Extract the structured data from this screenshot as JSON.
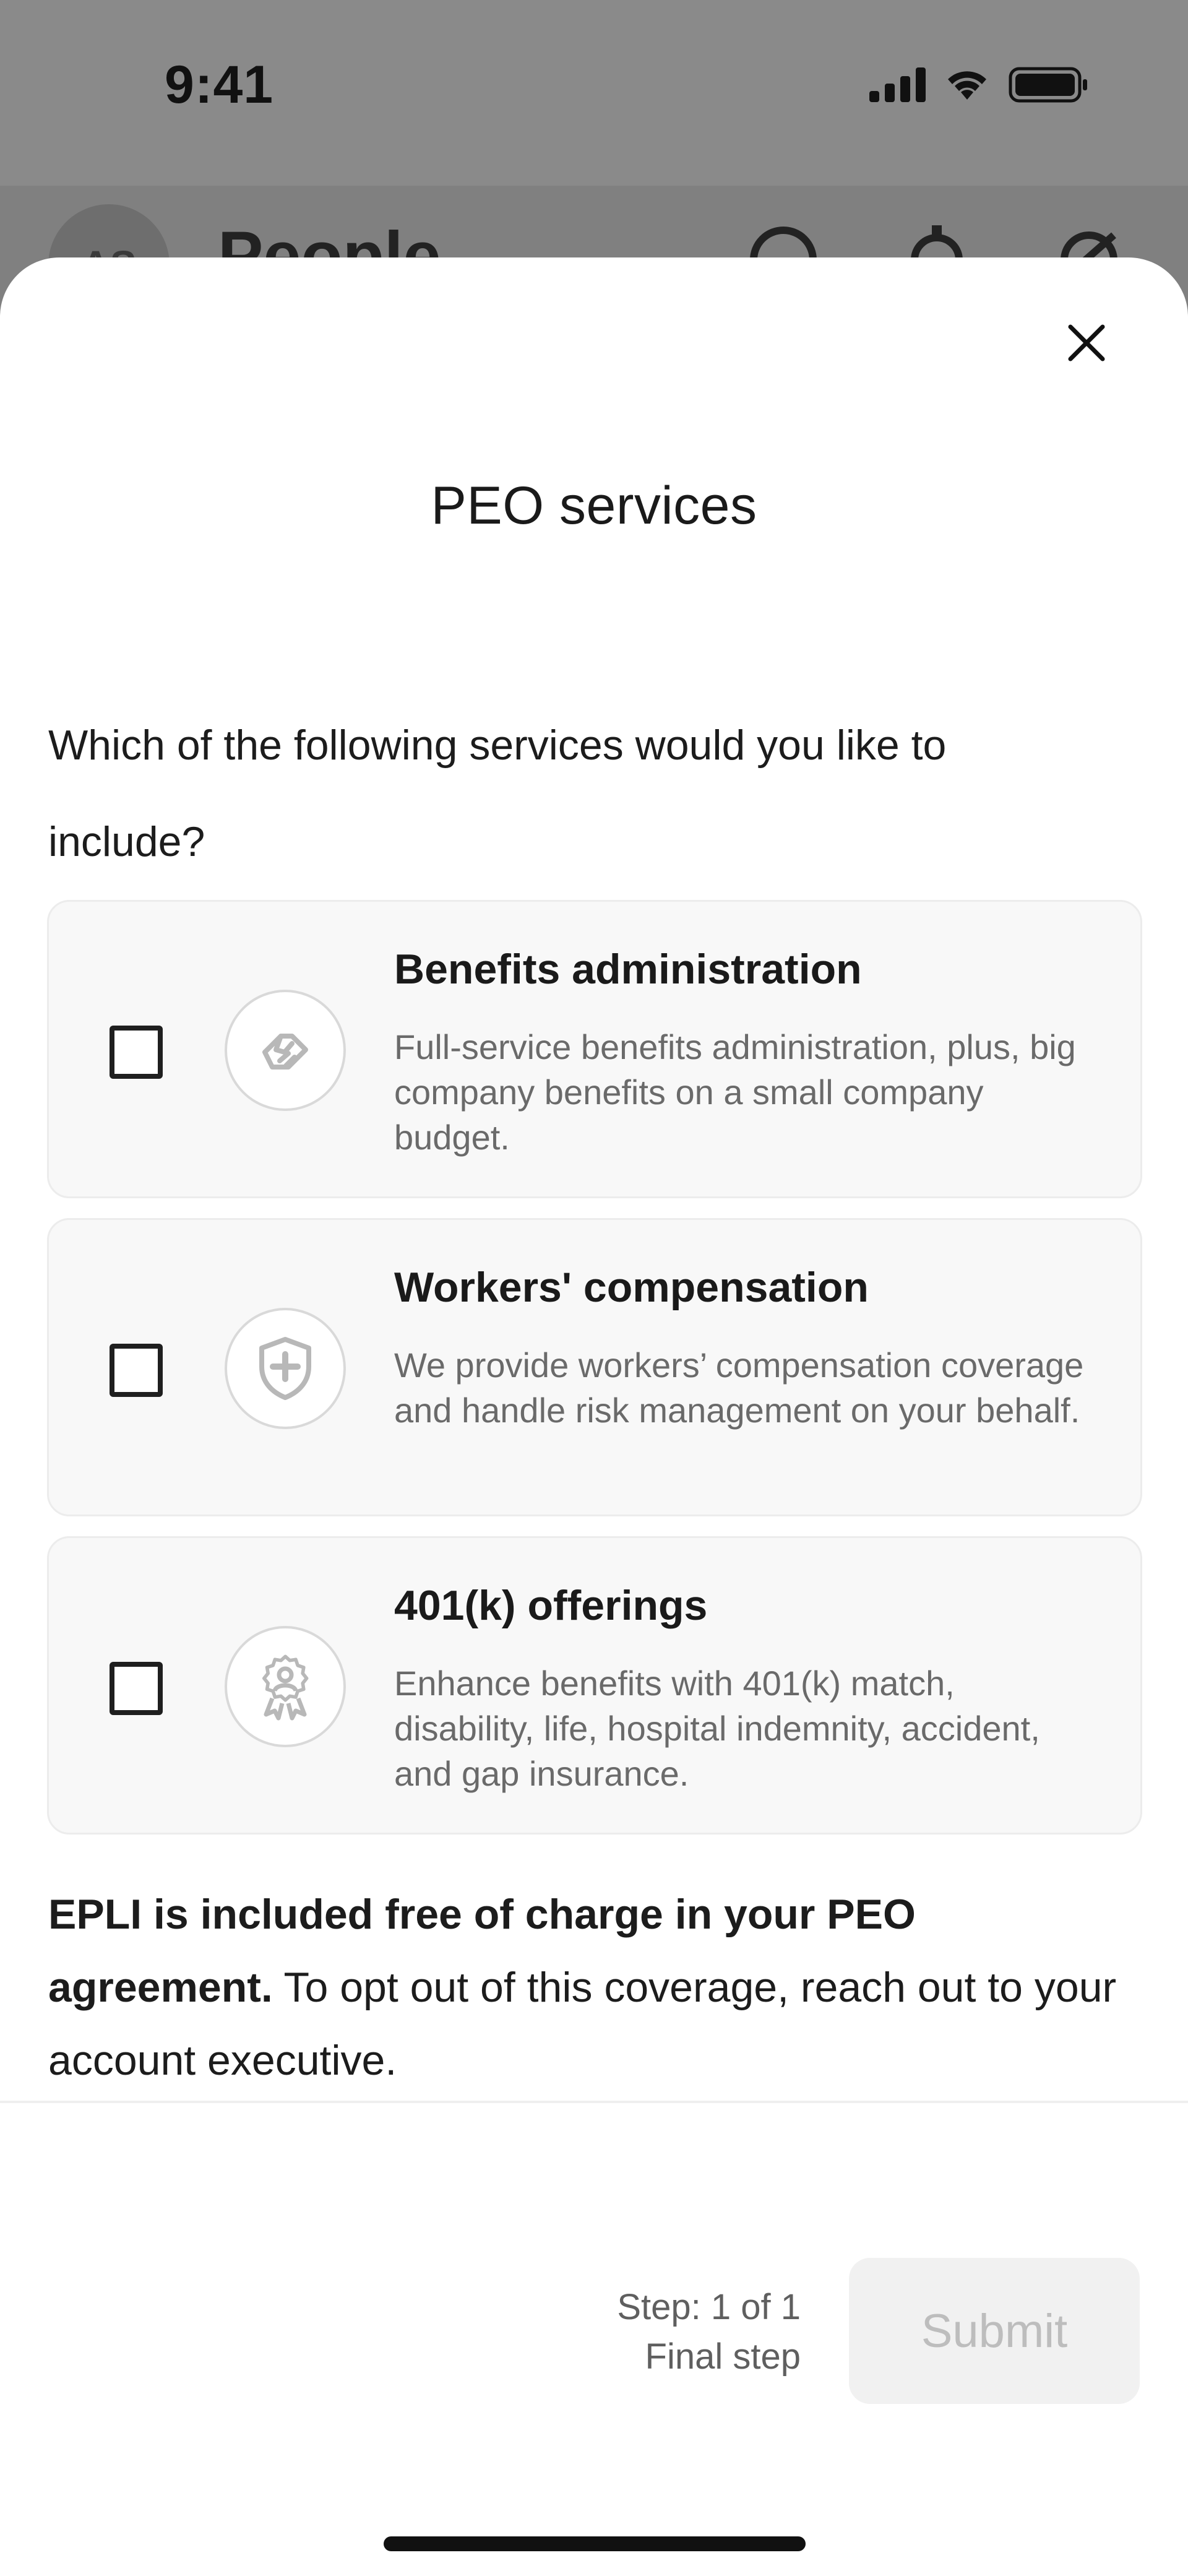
{
  "status_bar": {
    "time": "9:41"
  },
  "background_app": {
    "avatar_initials": "AS",
    "title": "People"
  },
  "sheet": {
    "title": "PEO services",
    "question": "Which of the following services would you like to include?",
    "options": [
      {
        "title": "Benefits administration",
        "description": "Full-service benefits administration, plus, big company benefits on a small company budget.",
        "icon": "handshake-icon",
        "checked": false
      },
      {
        "title": "Workers' compensation",
        "description": "We provide workers’ compensation coverage and handle risk management on your behalf.",
        "icon": "shield-plus-icon",
        "checked": false
      },
      {
        "title": "401(k) offerings",
        "description": "Enhance benefits with 401(k) match, disability, life, hospital indemnity, accident, and gap insurance.",
        "icon": "award-badge-icon",
        "checked": false
      }
    ],
    "epli_bold": "EPLI is included free of charge in your PEO agreement.",
    "epli_rest": " To opt out of this coverage, reach out to your account executive."
  },
  "footer": {
    "step": "Step: 1 of 1",
    "step_sub": "Final step",
    "submit_label": "Submit"
  },
  "colors": {
    "overlay": "#8a8a8a",
    "card_bg": "#f8f8f8",
    "submit_disabled_bg": "#f1f1f1",
    "submit_disabled_text": "#bdbdbd"
  }
}
